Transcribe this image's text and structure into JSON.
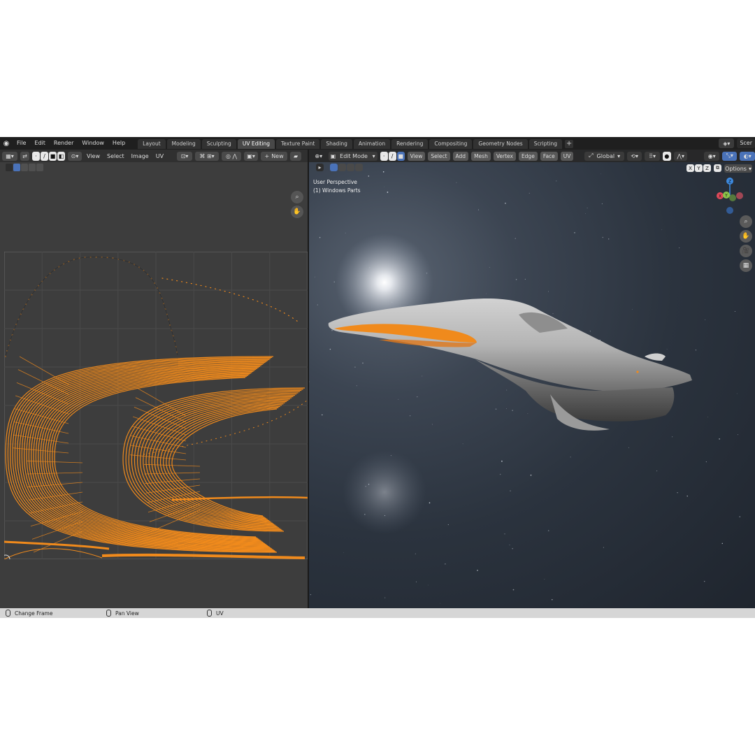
{
  "menu": [
    "File",
    "Edit",
    "Render",
    "Window",
    "Help"
  ],
  "workspaces": [
    {
      "label": "Layout",
      "active": false
    },
    {
      "label": "Modeling",
      "active": false
    },
    {
      "label": "Sculpting",
      "active": false
    },
    {
      "label": "UV Editing",
      "active": true
    },
    {
      "label": "Texture Paint",
      "active": false
    },
    {
      "label": "Shading",
      "active": false
    },
    {
      "label": "Animation",
      "active": false
    },
    {
      "label": "Rendering",
      "active": false
    },
    {
      "label": "Compositing",
      "active": false
    },
    {
      "label": "Geometry Nodes",
      "active": false
    },
    {
      "label": "Scripting",
      "active": false
    }
  ],
  "scene_label": "Scer",
  "uv_editor": {
    "menus": [
      "View",
      "Select",
      "Image",
      "UV"
    ],
    "new_label": "New"
  },
  "viewport": {
    "mode": "Edit Mode",
    "menus": [
      "View",
      "Select",
      "Add",
      "Mesh",
      "Vertex",
      "Edge",
      "Face",
      "UV"
    ],
    "transform_orientation": "Global",
    "axes": [
      "X",
      "Y",
      "Z"
    ],
    "options_label": "Options",
    "view_name": "User Perspective",
    "object_name": "(1) Windows Parts",
    "gizmo": {
      "x": "X",
      "y": "Y",
      "z": "Z"
    }
  },
  "status": [
    {
      "label": "Change Frame"
    },
    {
      "label": "Pan View"
    },
    {
      "label": "UV"
    }
  ],
  "colors": {
    "accent": "#4a72b8",
    "selection": "#f08a1c",
    "gizmo_x": "#e04a5a",
    "gizmo_y": "#8bc34a",
    "gizmo_z": "#3d8ae0"
  }
}
